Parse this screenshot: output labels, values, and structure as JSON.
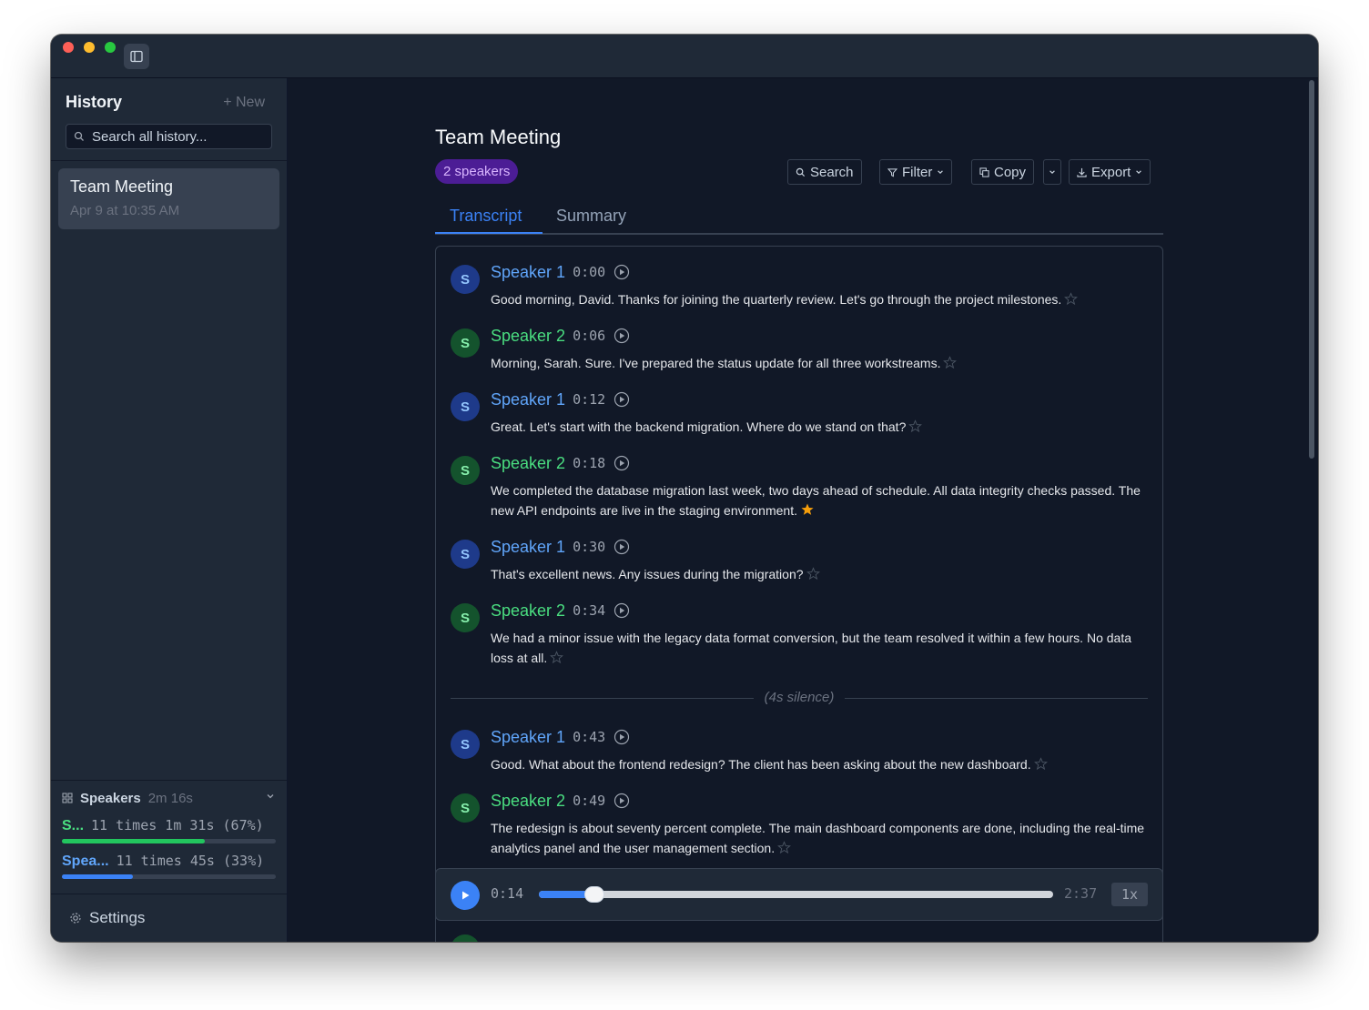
{
  "sidebar": {
    "title": "History",
    "new_label": "+ New",
    "search_placeholder": "Search all history...",
    "history_items": [
      {
        "title": "Team Meeting",
        "date": "Apr 9 at 10:35 AM"
      }
    ],
    "speakers_panel": {
      "title": "Speakers",
      "total_time": "2m 16s",
      "rows": [
        {
          "name": "S...",
          "stats": "11 times 1m 31s (67%)",
          "share_pct": 67,
          "color": "#22c55e",
          "name_color": "#4ade80"
        },
        {
          "name": "Spea...",
          "stats": "11 times 45s (33%)",
          "share_pct": 33,
          "color": "#3b82f6",
          "name_color": "#60a5fa"
        }
      ]
    },
    "settings_label": "Settings"
  },
  "main": {
    "title": "Team Meeting",
    "speakers_badge": "2 speakers",
    "toolbar": {
      "search": "Search",
      "filter": "Filter",
      "copy": "Copy",
      "export": "Export"
    },
    "tabs": [
      "Transcript",
      "Summary"
    ],
    "active_tab": "Transcript",
    "transcript": [
      {
        "speaker": "Speaker 1",
        "time": "0:00",
        "text": "Good morning, David. Thanks for joining the quarterly review. Let's go through the project milestones.",
        "starred": false
      },
      {
        "speaker": "Speaker 2",
        "time": "0:06",
        "text": "Morning, Sarah. Sure. I've prepared the status update for all three workstreams.",
        "starred": false
      },
      {
        "speaker": "Speaker 1",
        "time": "0:12",
        "text": "Great. Let's start with the backend migration. Where do we stand on that?",
        "starred": false
      },
      {
        "speaker": "Speaker 2",
        "time": "0:18",
        "text": "We completed the database migration last week, two days ahead of schedule. All data integrity checks passed. The new API endpoints are live in the staging environment.",
        "starred": true
      },
      {
        "speaker": "Speaker 1",
        "time": "0:30",
        "text": "That's excellent news. Any issues during the migration?",
        "starred": false
      },
      {
        "speaker": "Speaker 2",
        "time": "0:34",
        "text": "We had a minor issue with the legacy data format conversion, but the team resolved it within a few hours. No data loss at all.",
        "starred": false
      },
      {
        "speaker": "Speaker 1",
        "time": "0:43",
        "text": "Good. What about the frontend redesign? The client has been asking about the new dashboard.",
        "starred": false
      },
      {
        "speaker": "Speaker 2",
        "time": "0:49",
        "text": "The redesign is about seventy percent complete. The main dashboard components are done, including the real-time analytics panel and the user management section.",
        "starred": false
      }
    ],
    "avatar_letter": "S",
    "silence_label": "(4s silence)",
    "player": {
      "current": "0:14",
      "duration": "2:37",
      "progress": 0.089,
      "speed": "1x"
    }
  },
  "colors": {
    "accent": "#3b82f6",
    "speaker1": "#60a5fa",
    "speaker2": "#4ade80",
    "star_active": "#f59e0b",
    "badge_bg": "#4c1d95"
  }
}
